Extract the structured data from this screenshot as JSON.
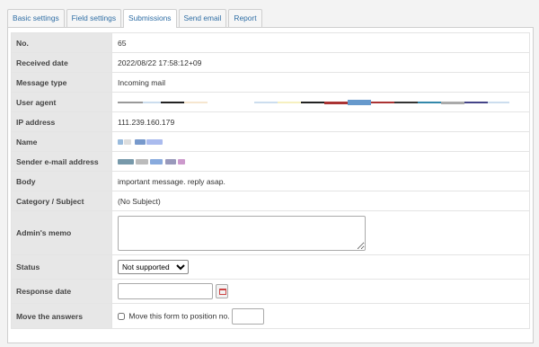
{
  "tabs": [
    {
      "label": "Basic settings"
    },
    {
      "label": "Field settings"
    },
    {
      "label": "Submissions"
    },
    {
      "label": "Send email"
    },
    {
      "label": "Report"
    }
  ],
  "rows": {
    "no": {
      "label": "No.",
      "value": "65"
    },
    "received": {
      "label": "Received date",
      "value": "2022/08/22 17:58:12+09"
    },
    "msgtype": {
      "label": "Message type",
      "value": "Incoming mail"
    },
    "useragent": {
      "label": "User agent"
    },
    "ip": {
      "label": "IP address",
      "value": "111.239.160.179"
    },
    "name": {
      "label": "Name"
    },
    "sender": {
      "label": "Sender e-mail address"
    },
    "body": {
      "label": "Body",
      "value": "important message. reply asap."
    },
    "category": {
      "label": "Category / Subject",
      "value": "(No Subject)"
    },
    "memo": {
      "label": "Admin's memo",
      "value": ""
    },
    "status": {
      "label": "Status",
      "selected": "Not supported"
    },
    "response": {
      "label": "Response date",
      "value": ""
    },
    "move": {
      "label": "Move the answers",
      "checkbox_label": "Move this form to position no.",
      "value": ""
    }
  },
  "icons": {
    "calendar": "calendar-icon"
  }
}
